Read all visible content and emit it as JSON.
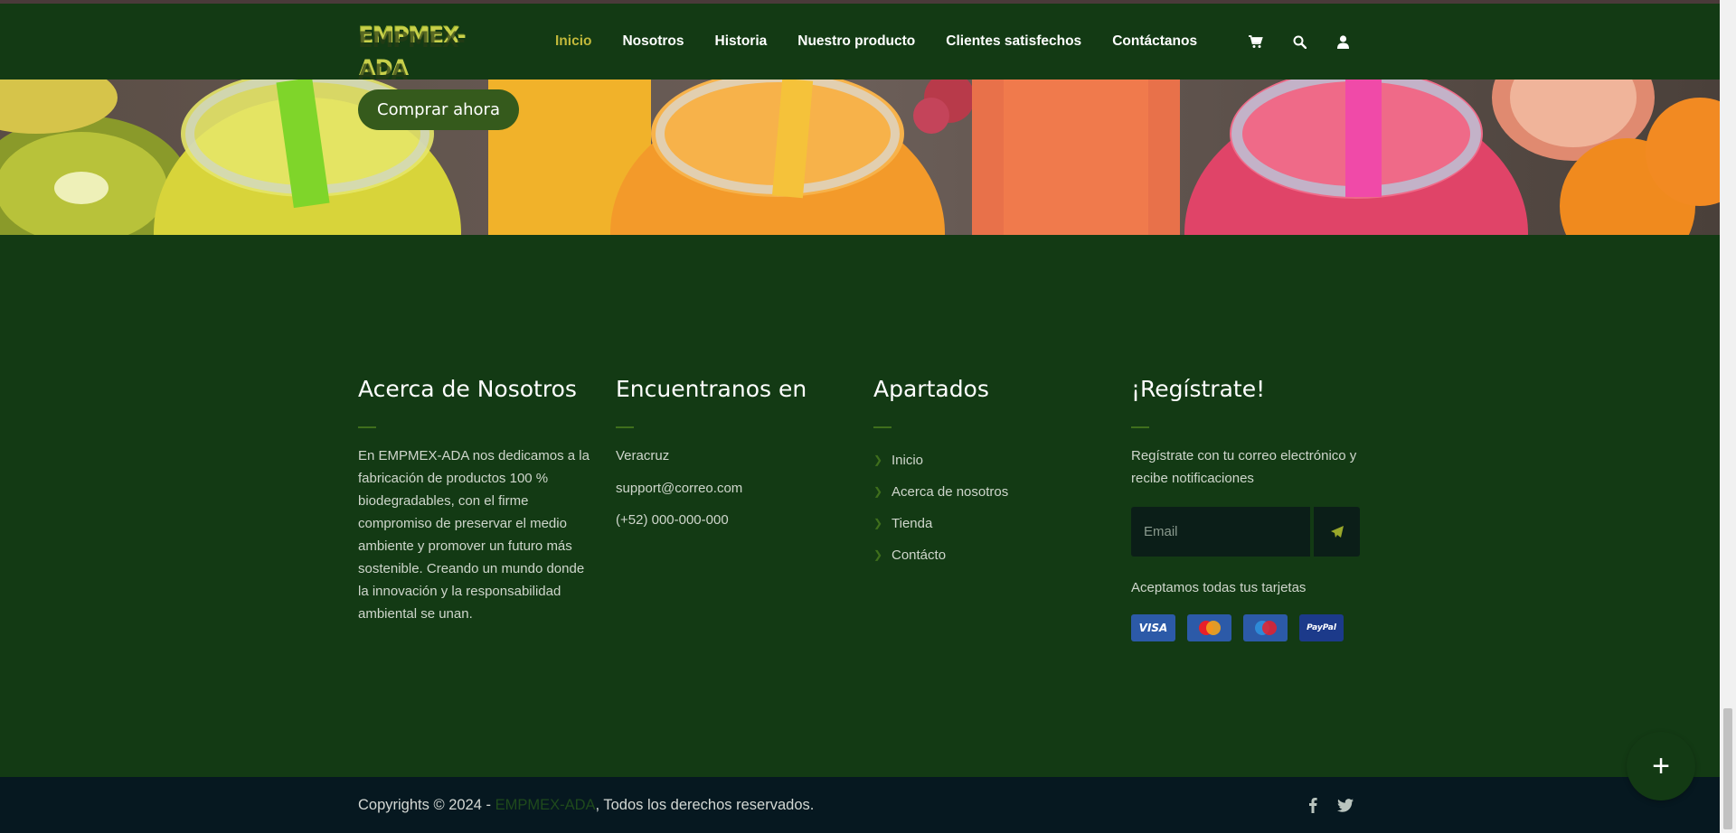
{
  "header": {
    "logo_text": "EMPMEX-ADA",
    "nav": [
      {
        "label": "Inicio",
        "active": true
      },
      {
        "label": "Nosotros",
        "active": false
      },
      {
        "label": "Historia",
        "active": false
      },
      {
        "label": "Nuestro producto",
        "active": false
      },
      {
        "label": "Clientes satisfechos",
        "active": false
      },
      {
        "label": "Contáctanos",
        "active": false
      }
    ],
    "icons": [
      "cart-icon",
      "search-icon",
      "user-icon"
    ]
  },
  "banner": {
    "buy_label": "Comprar ahora"
  },
  "footer": {
    "about": {
      "title": "Acerca de Nosotros",
      "text": "En EMPMEX-ADA nos dedicamos a la fabricación de productos 100 % biodegradables, con el firme compromiso de preservar el medio ambiente y promover un futuro más sostenible. Creando un mundo donde la innovación y la responsabilidad ambiental se unan."
    },
    "find": {
      "title": "Encuentranos en",
      "location": "Veracruz",
      "email": "support@correo.com",
      "phone": "(+52) 000-000-000"
    },
    "sections": {
      "title": "Apartados",
      "items": [
        "Inicio",
        "Acerca de nosotros",
        "Tienda",
        "Contácto"
      ]
    },
    "register": {
      "title": "¡Regístrate!",
      "text": "Regístrate con tu correo electrónico y recibe notificaciones",
      "email_placeholder": "Email",
      "cards_label": "Aceptamos todas tus tarjetas",
      "cards": [
        "VISA",
        "MasterCard",
        "Maestro",
        "PayPal"
      ]
    }
  },
  "bottom": {
    "copy_prefix": "Copyrights © 2024 - ",
    "brand": "EMPMEX-ADA",
    "copy_suffix": ", Todos los derechos reservados.",
    "social": [
      "facebook-icon",
      "twitter-icon"
    ]
  },
  "fab_label": "+",
  "colors": {
    "background": "#133a14",
    "bottom_bar": "#061820",
    "accent_active": "#c2b93b",
    "button": "#355a1c"
  }
}
